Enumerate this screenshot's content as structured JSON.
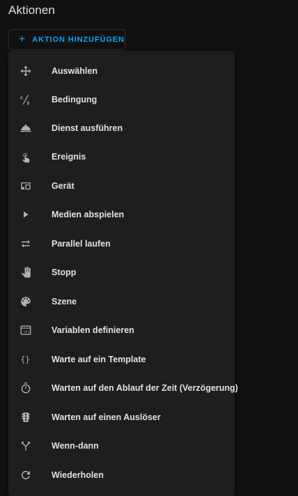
{
  "section": {
    "title": "Aktionen"
  },
  "add_button": {
    "label": "AKTION HINZUFÜGEN",
    "plus_icon": "plus-icon"
  },
  "colors": {
    "accent": "#03a9f4",
    "menu_bg": "#1e1e1e",
    "page_bg": "#111111",
    "text": "#e1e1e1",
    "icon": "#b0b0b0"
  },
  "menu": {
    "items": [
      {
        "label": "Auswählen",
        "icon": "arrow-all-icon"
      },
      {
        "label": "Bedingung",
        "icon": "ab-testing-icon"
      },
      {
        "label": "Dienst ausführen",
        "icon": "room-service-icon"
      },
      {
        "label": "Ereignis",
        "icon": "gesture-tap-icon"
      },
      {
        "label": "Gerät",
        "icon": "devices-icon"
      },
      {
        "label": "Medien abspielen",
        "icon": "play-icon"
      },
      {
        "label": "Parallel laufen",
        "icon": "shuffle-disabled-icon"
      },
      {
        "label": "Stopp",
        "icon": "hand-back-icon"
      },
      {
        "label": "Szene",
        "icon": "palette-icon"
      },
      {
        "label": "Variablen definieren",
        "icon": "application-variable-icon"
      },
      {
        "label": "Warte auf ein Template",
        "icon": "code-braces-icon"
      },
      {
        "label": "Warten auf den Ablauf der Zeit (Verzögerung)",
        "icon": "timer-outline-icon"
      },
      {
        "label": "Warten auf einen Auslöser",
        "icon": "traffic-light-icon"
      },
      {
        "label": "Wenn-dann",
        "icon": "call-split-icon"
      },
      {
        "label": "Wiederholen",
        "icon": "refresh-icon"
      }
    ]
  }
}
